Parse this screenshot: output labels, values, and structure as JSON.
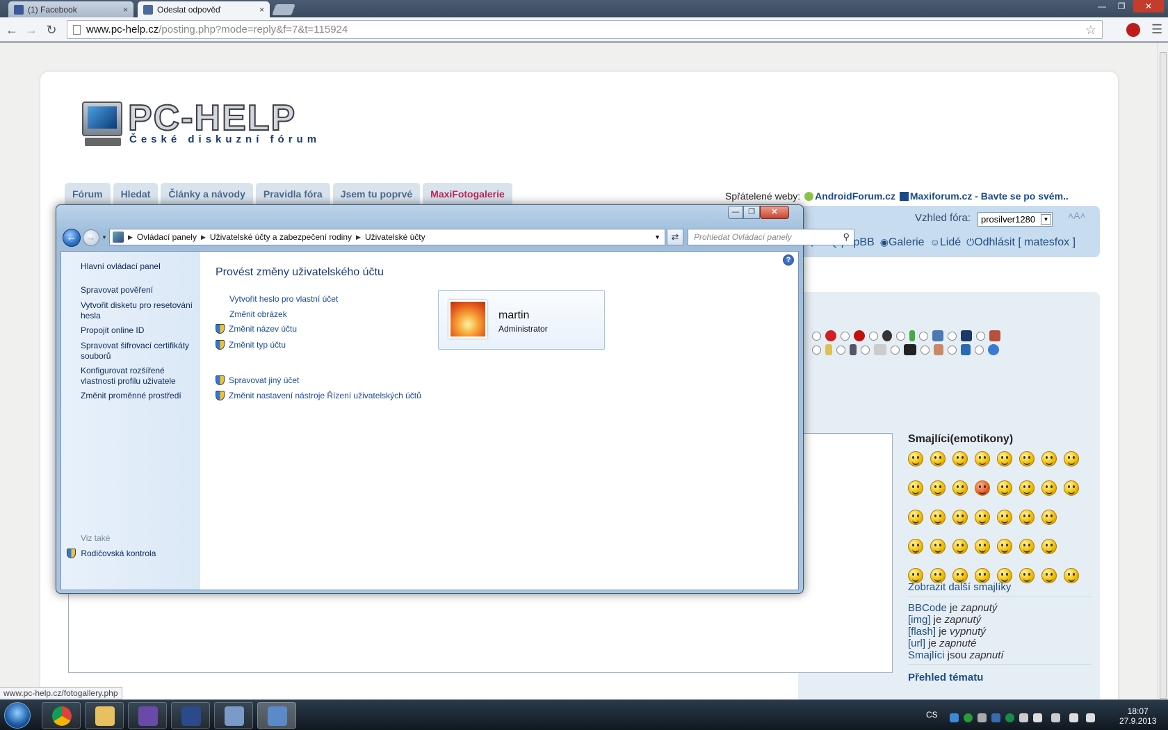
{
  "browser": {
    "tabs": [
      {
        "label": "(1) Facebook",
        "close": "×"
      },
      {
        "label": "Odeslat odpověď",
        "close": "×"
      }
    ],
    "url_host": "www.pc-help.cz",
    "url_path": "/posting.php?mode=reply&f=7&t=115924",
    "status_url": "www.pc-help.cz/fotogallery.php"
  },
  "site": {
    "logo_title": "PC-HELP",
    "logo_subtitle": "České diskuzní fórum",
    "nav": [
      "Fórum",
      "Hledat",
      "Články a návody",
      "Pravidla fóra",
      "Jsem tu poprvé",
      "MaxiFotogalerie"
    ],
    "friends_label": "Spřátelené weby:",
    "friends_link1": "AndroidForum.cz",
    "friends_link2": "Maxiforum.cz - Bavte se po svém..",
    "style_label": "Vzhled fóra:",
    "style_value": "prosilver1280",
    "userlinks": [
      "FAQ phpBB",
      "Galerie",
      "Lidé",
      "Odhlásit [ matesfox ]"
    ],
    "smilies_title": "Smajlíci(emotikony)",
    "more_smilies": "Zobrazit další smajlíky",
    "codes": [
      {
        "name": "BBCode",
        "mid": " je ",
        "state": "zapnutý"
      },
      {
        "name": "[img]",
        "mid": " je ",
        "state": "zapnutý"
      },
      {
        "name": "[flash]",
        "mid": " je ",
        "state": "vypnutý"
      },
      {
        "name": "[url]",
        "mid": " je ",
        "state": "zapnuté"
      },
      {
        "name": "Smajlíci",
        "mid": " jsou ",
        "state": "zapnutí"
      }
    ],
    "topic_review": "Přehled tématu"
  },
  "cp": {
    "breadcrumb": [
      "Ovládací panely",
      "Uživatelské účty a zabezpečení rodiny",
      "Uživatelské účty"
    ],
    "search_placeholder": "Prohledat Ovládací panely",
    "left_links": [
      "Hlavní ovládací panel",
      "Spravovat pověření",
      "Vytvořit disketu pro resetování hesla",
      "Propojit online ID",
      "Spravovat šifrovací certifikáty souborů",
      "Konfigurovat rozšířené vlastnosti profilu uživatele",
      "Změnit proměnné prostředí"
    ],
    "see_also": "Viz také",
    "parental": "Rodičovská kontrola",
    "title": "Provést změny uživatelského účtu",
    "links": [
      "Vytvořit heslo pro vlastní účet",
      "Změnit obrázek",
      "Změnit název účtu",
      "Změnit typ účtu",
      "Spravovat jiný účet",
      "Změnit nastavení nástroje Řízení uživatelských účtů"
    ],
    "user_name": "martin",
    "user_role": "Administrator",
    "help": "?"
  },
  "taskbar": {
    "lang": "CS",
    "time": "18:07",
    "date": "27.9.2013"
  },
  "colors": {
    "accent": "#bf2654",
    "link": "#1d4f85"
  }
}
